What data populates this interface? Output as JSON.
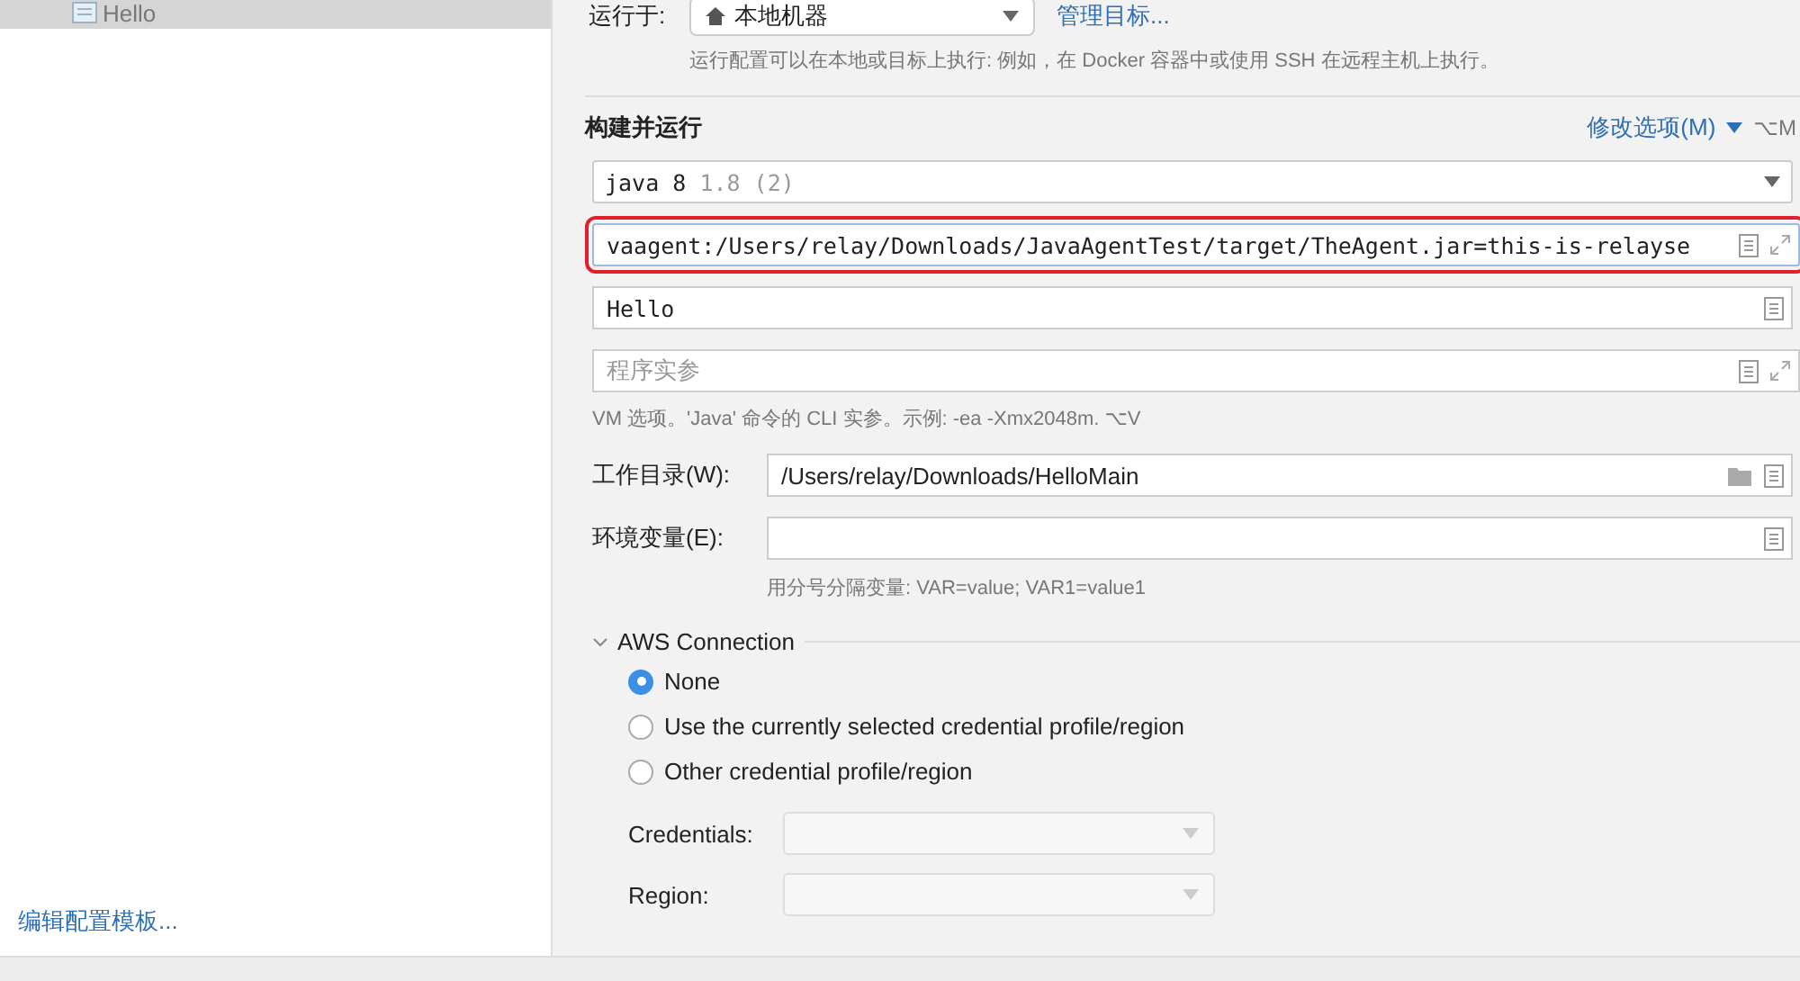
{
  "sidebar": {
    "tree_items": [
      {
        "label": "Hello",
        "selected": true
      }
    ],
    "footer_link": "编辑配置模板..."
  },
  "run_on": {
    "label": "运行于:",
    "value": "本地机器",
    "link": "管理目标...",
    "hint": "运行配置可以在本地或目标上执行: 例如，在 Docker 容器中或使用 SSH 在远程主机上执行。"
  },
  "build_and_run": {
    "title": "构建并运行",
    "modify_options": "修改选项(M)",
    "shortcut": "⌥M",
    "jdk": {
      "name": "java 8",
      "version": "1.8 (2)"
    },
    "vm_options": {
      "value": "vaagent:/Users/relay/Downloads/JavaAgentTest/target/TheAgent.jar=this-is-relayse",
      "highlighted": true
    },
    "main_class": {
      "value": "Hello"
    },
    "program_args": {
      "placeholder": "程序实参"
    },
    "hint": "VM 选项。'Java' 命令的 CLI 实参。示例: -ea -Xmx2048m. ⌥V"
  },
  "working_dir": {
    "label": "工作目录(W):",
    "value": "/Users/relay/Downloads/HelloMain"
  },
  "env_vars": {
    "label": "环境变量(E):",
    "hint": "用分号分隔变量: VAR=value; VAR1=value1"
  },
  "aws": {
    "title": "AWS Connection",
    "expanded": true,
    "options": [
      {
        "label": "None",
        "selected": true
      },
      {
        "label": "Use the currently selected credential profile/region",
        "selected": false
      },
      {
        "label": "Other credential profile/region",
        "selected": false
      }
    ],
    "fields": [
      {
        "label": "Credentials:",
        "disabled": true
      },
      {
        "label": "Region:",
        "disabled": true
      }
    ]
  }
}
